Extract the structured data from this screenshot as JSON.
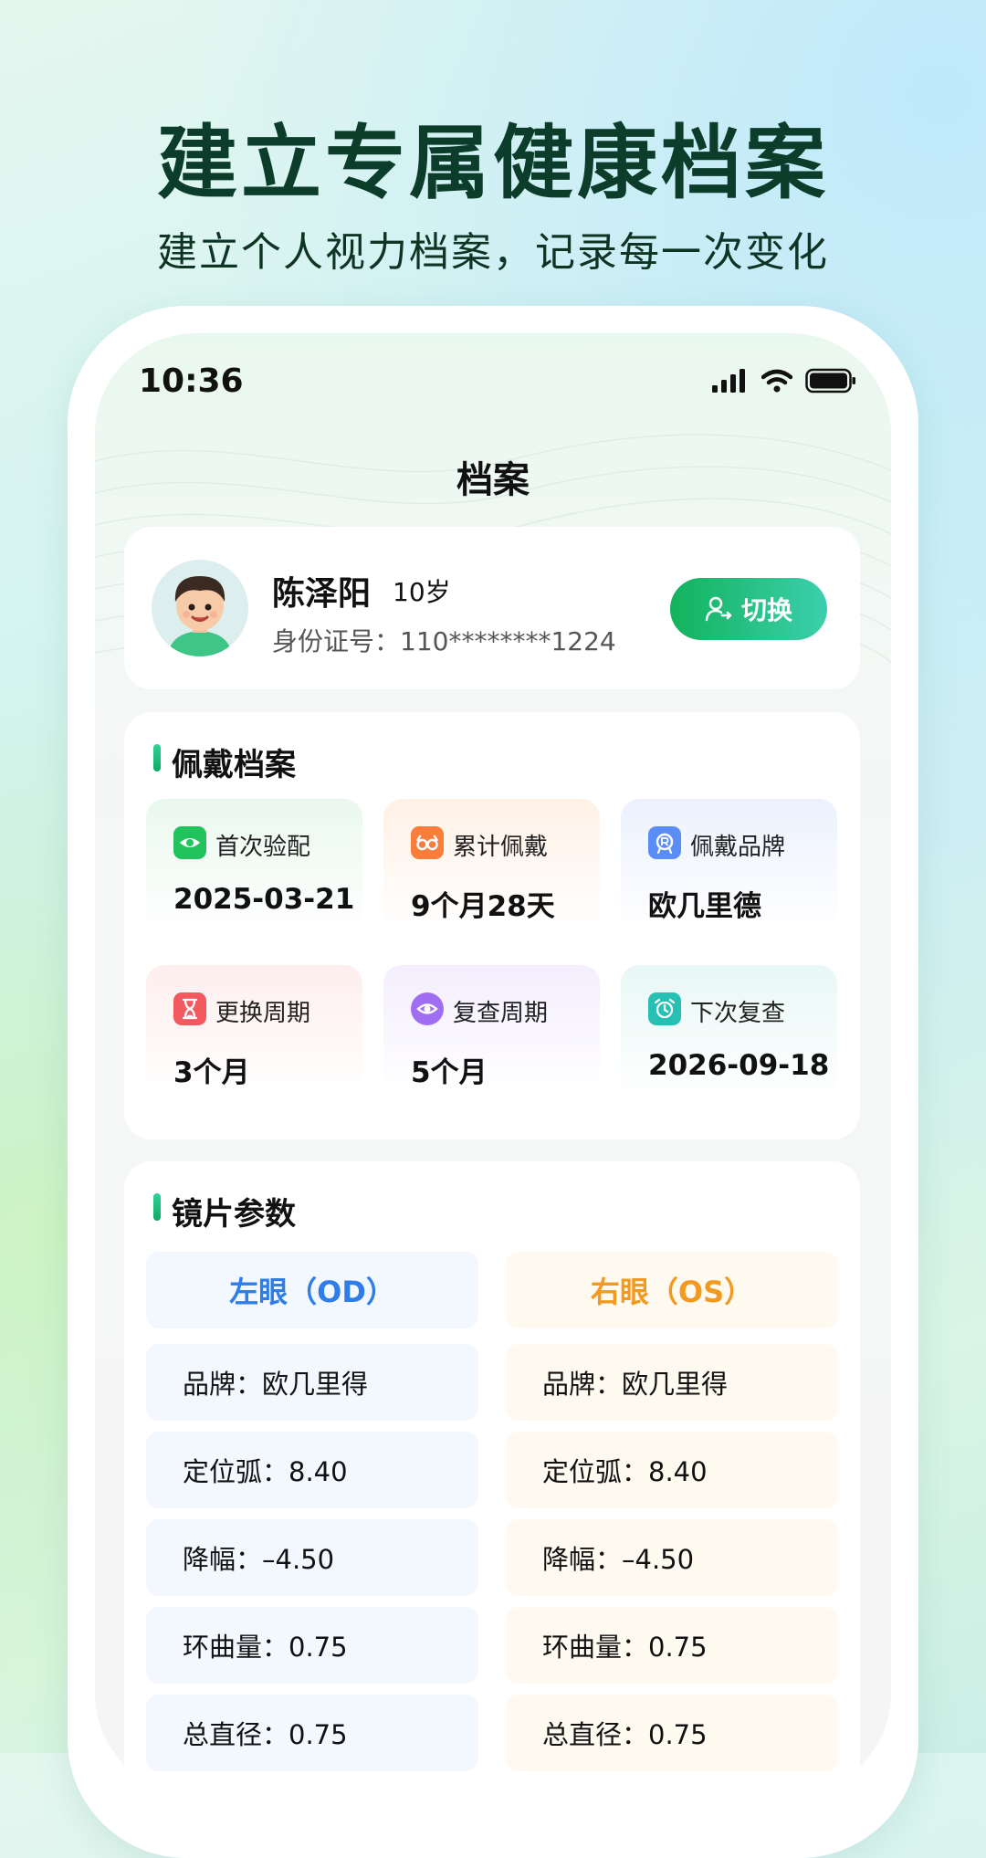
{
  "headline": "建立专属健康档案",
  "subline": "建立个人视力档案，记录每一次变化",
  "status_bar": {
    "time": "10:36",
    "icons": [
      "signal-icon",
      "wifi-icon",
      "battery-icon"
    ]
  },
  "page_title": "档案",
  "profile": {
    "name": "陈泽阳",
    "age": "10岁",
    "id_label": "身份证号：",
    "id_value": "110********1224",
    "switch_label": "切换",
    "switch_color": "#12b35c"
  },
  "wear_archive": {
    "title": "佩戴档案",
    "items": [
      {
        "icon": "eye-icon",
        "label": "首次验配",
        "value": "2025-03-21",
        "color": "#22c25c"
      },
      {
        "icon": "glasses-icon",
        "label": "累计佩戴",
        "value": "9个月28天",
        "color": "#fb7d3c"
      },
      {
        "icon": "brand-icon",
        "label": "佩戴品牌",
        "value": "欧几里德",
        "color": "#5b8df7"
      },
      {
        "icon": "hourglass-icon",
        "label": "更换周期",
        "value": "3个月",
        "color": "#f25a5f"
      },
      {
        "icon": "eye-scan-icon",
        "label": "复查周期",
        "value": "5个月",
        "color": "#a06ef2"
      },
      {
        "icon": "alarm-icon",
        "label": "下次复查",
        "value": "2026-09-18",
        "color": "#26c0b4"
      }
    ]
  },
  "lens_params": {
    "title": "镜片参数",
    "left_header": "左眼（OD）",
    "right_header": "右眼（OS）",
    "left_color": "#2f7de8",
    "right_color": "#f29a1f",
    "left_rows": [
      "品牌：欧几里得",
      "定位弧：8.40",
      "降幅：–4.50",
      "环曲量：0.75",
      "总直径：0.75"
    ],
    "right_rows": [
      "品牌：欧几里得",
      "定位弧：8.40",
      "降幅：–4.50",
      "环曲量：0.75",
      "总直径：0.75"
    ]
  }
}
